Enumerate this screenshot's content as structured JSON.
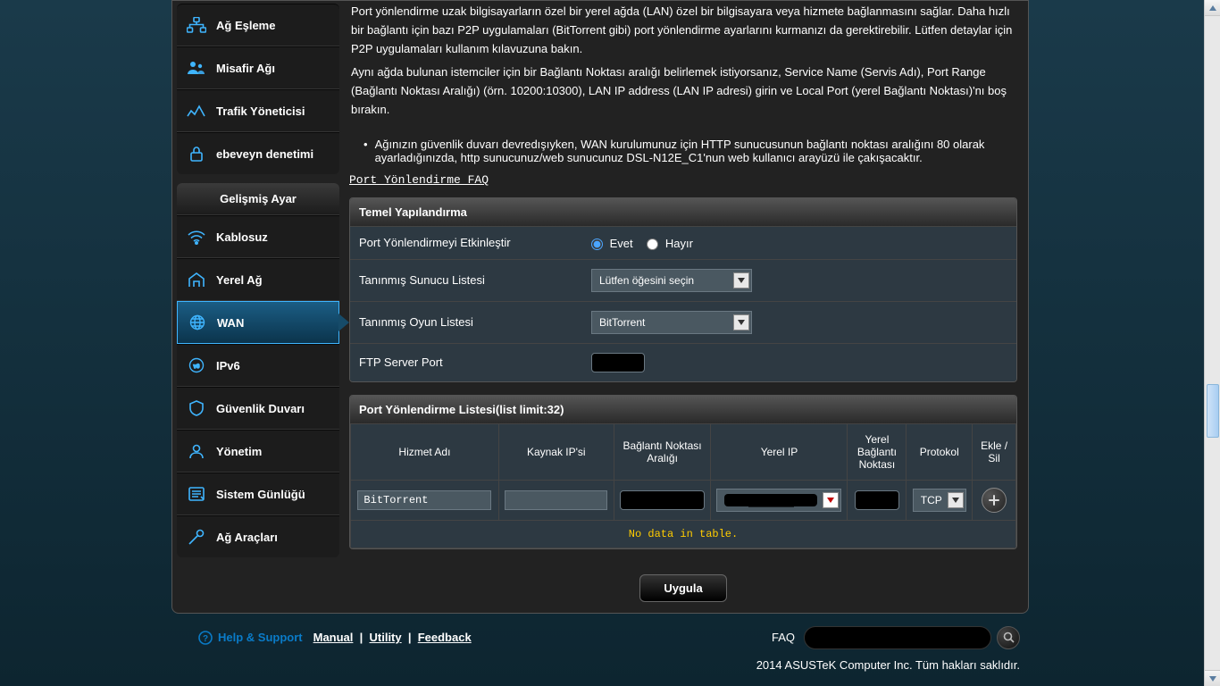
{
  "nav_top": [
    {
      "label": "Ağ Eşleme",
      "icon": "network-map-icon"
    },
    {
      "label": "Misafir Ağı",
      "icon": "guest-network-icon"
    },
    {
      "label": "Trafik Yöneticisi",
      "icon": "traffic-manager-icon"
    },
    {
      "label": "ebeveyn denetimi",
      "icon": "parental-controls-icon"
    }
  ],
  "nav_section_title": "Gelişmiş Ayar",
  "nav_advanced": [
    {
      "label": "Kablosuz",
      "icon": "wireless-icon"
    },
    {
      "label": "Yerel Ağ",
      "icon": "lan-icon"
    },
    {
      "label": "WAN",
      "icon": "wan-icon",
      "active": true
    },
    {
      "label": "IPv6",
      "icon": "ipv6-icon"
    },
    {
      "label": "Güvenlik Duvarı",
      "icon": "firewall-icon"
    },
    {
      "label": "Yönetim",
      "icon": "admin-icon"
    },
    {
      "label": "Sistem Günlüğü",
      "icon": "syslog-icon"
    },
    {
      "label": "Ağ Araçları",
      "icon": "nettools-icon"
    }
  ],
  "intro": {
    "p1": "Port yönlendirme uzak bilgisayarların özel bir yerel ağda (LAN) özel bir bilgisayara veya hizmete bağlanmasını sağlar. Daha hızlı bir bağlantı için bazı P2P uygulamaları (BitTorrent gibi) port yönlendirme ayarlarını kurmanızı da gerektirebilir. Lütfen detaylar için P2P uygulamaları kullanım kılavuzuna bakın.",
    "p2": "Aynı ağda bulunan istemciler için bir Bağlantı Noktası aralığı belirlemek istiyorsanız, Service Name (Servis Adı), Port Range (Bağlantı Noktası Aralığı) (örn. 10200:10300), LAN IP address (LAN IP adresi) girin ve Local Port (yerel Bağlantı Noktası)'nı boş bırakın.",
    "bullet": "Ağınızın güvenlik duvarı devredışıyken, WAN kurulumunuz için HTTP sunucusunun bağlantı noktası aralığını 80 olarak ayarladığınızda, http sunucunuz/web sunucunuz DSL-N12E_C1'nun web kullanıcı arayüzü ile çakışacaktır.",
    "faq_link": "Port Yönlendirme FAQ"
  },
  "basic_config": {
    "title": "Temel Yapılandırma",
    "rows": {
      "enable": {
        "label": "Port Yönlendirmeyi Etkinleştir",
        "yes": "Evet",
        "no": "Hayır",
        "value": "yes"
      },
      "server_list": {
        "label": "Tanınmış Sunucu Listesi",
        "value": "Lütfen öğesini seçin"
      },
      "game_list": {
        "label": "Tanınmış Oyun Listesi",
        "value": "BitTorrent"
      },
      "ftp": {
        "label": "FTP Server Port",
        "value": "████"
      }
    }
  },
  "pf_list": {
    "title": "Port Yönlendirme Listesi(list limit:32)",
    "cols": [
      "Hizmet Adı",
      "Kaynak IP'si",
      "Bağlantı Noktası Aralığı",
      "Yerel IP",
      "Yerel Bağlantı Noktası",
      "Protokol",
      "Ekle / Sil"
    ],
    "input_row": {
      "service": "BitTorrent",
      "source_ip": "",
      "port_range": "██████",
      "local_ip": "██████",
      "local_port": "██",
      "protocol": "TCP"
    },
    "empty": "No data in table."
  },
  "apply_label": "Uygula",
  "footer": {
    "help": "Help & Support",
    "manual": "Manual",
    "utility": "Utility",
    "feedback": "Feedback",
    "faq": "FAQ",
    "copyright": "2014 ASUSTeK Computer Inc. Tüm hakları saklıdır."
  }
}
